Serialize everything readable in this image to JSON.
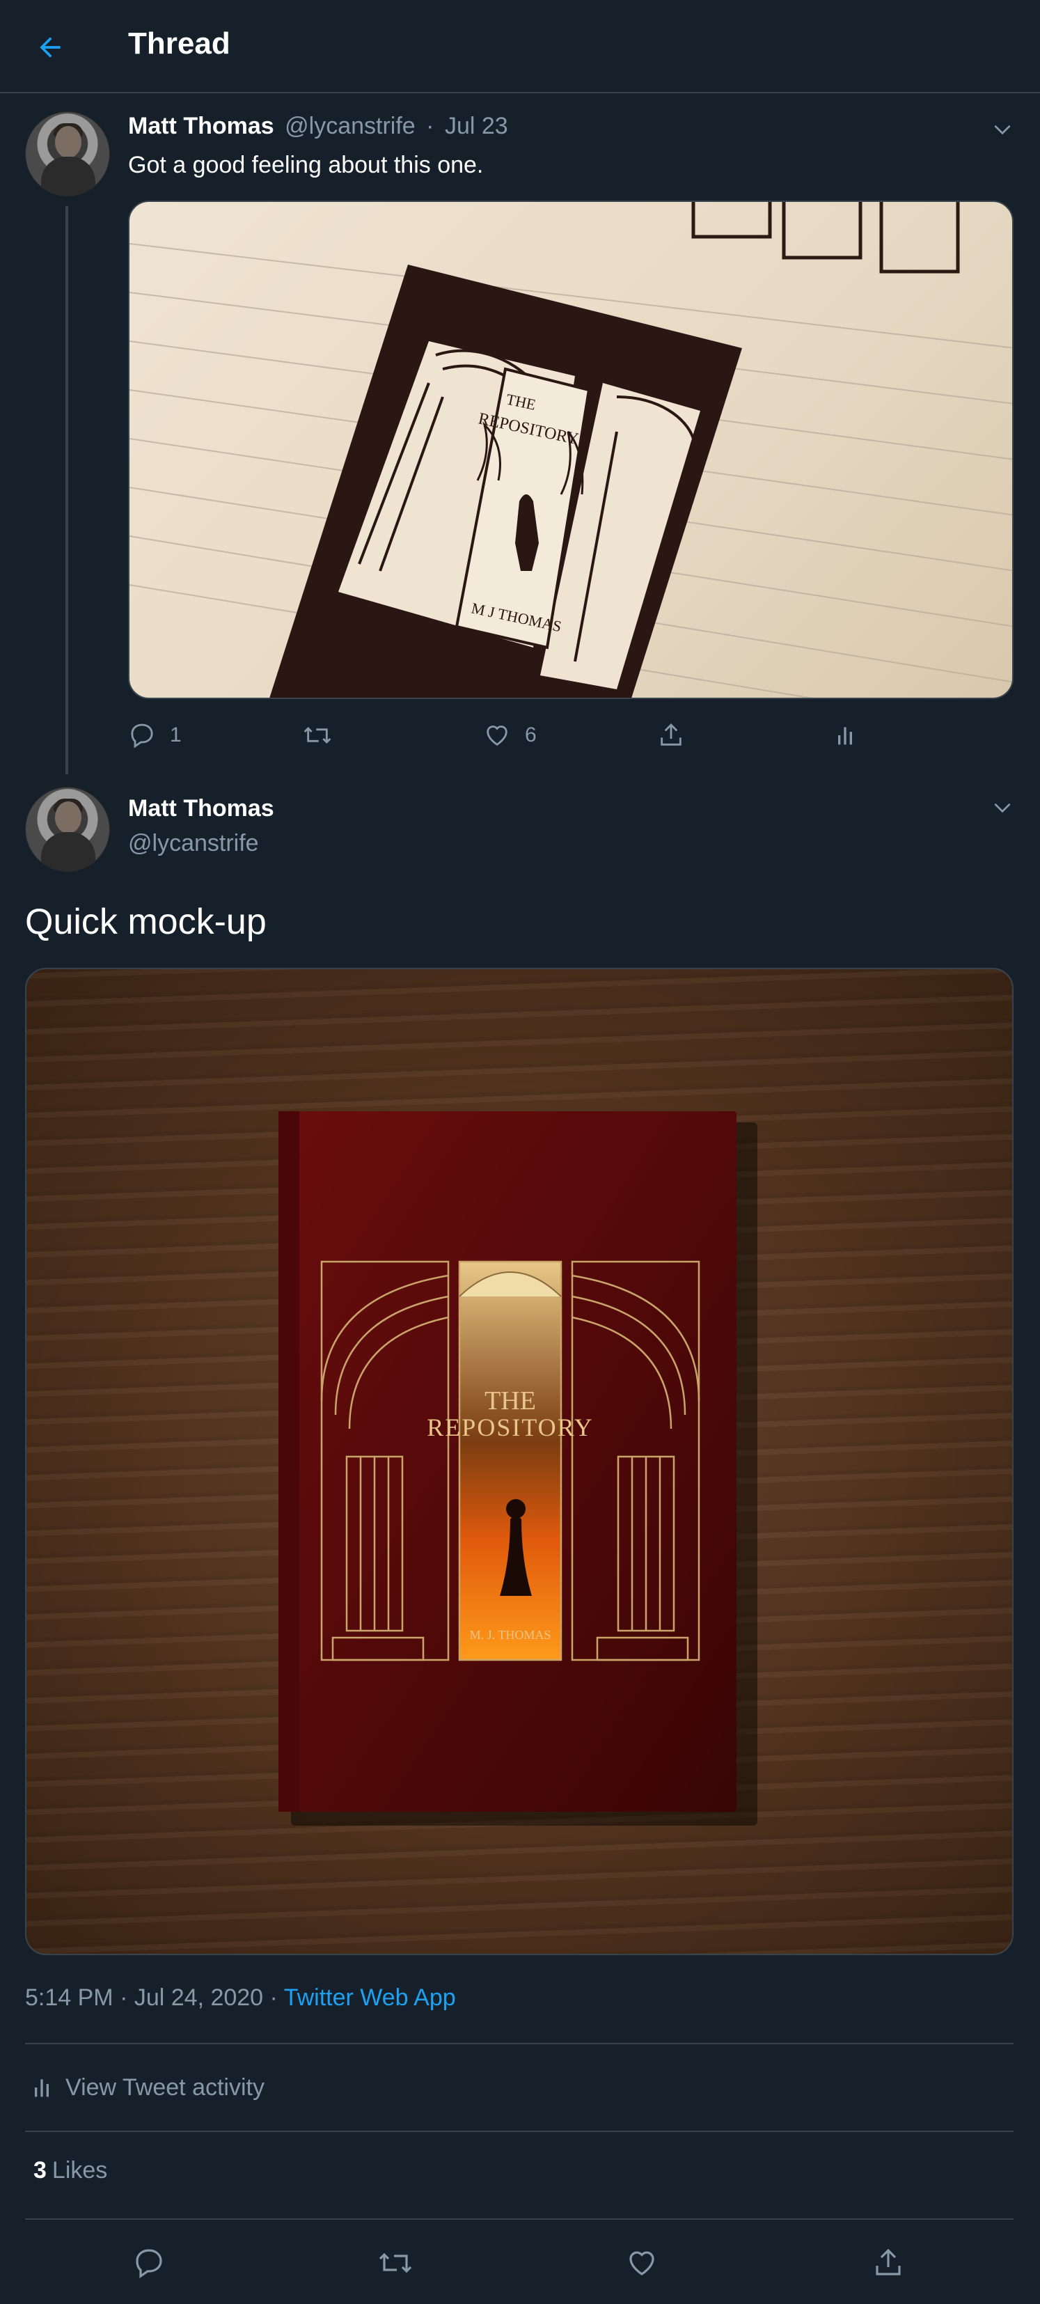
{
  "header": {
    "title": "Thread",
    "back_icon": "arrow-left-icon"
  },
  "colors": {
    "background": "#15202b",
    "accent": "#1da1f2",
    "muted": "#8899a6",
    "border": "#38444d"
  },
  "tweet1": {
    "name": "Matt Thomas",
    "handle": "@lycanstrife",
    "separator": "·",
    "date": "Jul 23",
    "text": "Got a good feeling about this one.",
    "image_text": {
      "title_line1": "THE",
      "title_line2": "REPOSITORY",
      "author": "M J THOMAS"
    },
    "replies": "1",
    "likes": "6"
  },
  "tweet2": {
    "name": "Matt Thomas",
    "handle": "@lycanstrife",
    "text": "Quick mock-up",
    "image_text": {
      "title_line1": "THE",
      "title_line2": "REPOSITORY",
      "author": "M. J. THOMAS"
    },
    "time": "5:14 PM · Jul 24, 2020",
    "separator": "·",
    "source": "Twitter Web App",
    "activity_label": "View Tweet activity",
    "likes_count": "3",
    "likes_label": "Likes"
  }
}
